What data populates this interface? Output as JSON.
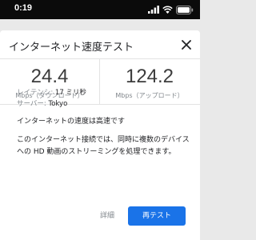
{
  "status_bar": {
    "time": "0:19",
    "icons": [
      "signal-icon",
      "wifi-icon",
      "battery-icon"
    ]
  },
  "header": {
    "title": "インターネット速度テスト",
    "close_icon": "close-icon"
  },
  "speeds": {
    "download": {
      "value": "24.4",
      "label": "Mbps（ダウンロード）"
    },
    "upload": {
      "value": "124.2",
      "label": "Mbps（アップロード）"
    }
  },
  "details": {
    "latency_label": "レイテンシ: ",
    "latency_value": "17 ミリ秒",
    "server_label": "サーバー: ",
    "server_value": "Tokyo"
  },
  "result": "インターネットの速度は高速です",
  "description": "このインターネット接続では、同時に複数のデバイスへの HD 動画のストリーミングを処理できます。",
  "actions": {
    "details": "詳細",
    "retest": "再テスト"
  },
  "colors": {
    "accent": "#1a73e8",
    "status_bar": "#0b0b0b"
  }
}
